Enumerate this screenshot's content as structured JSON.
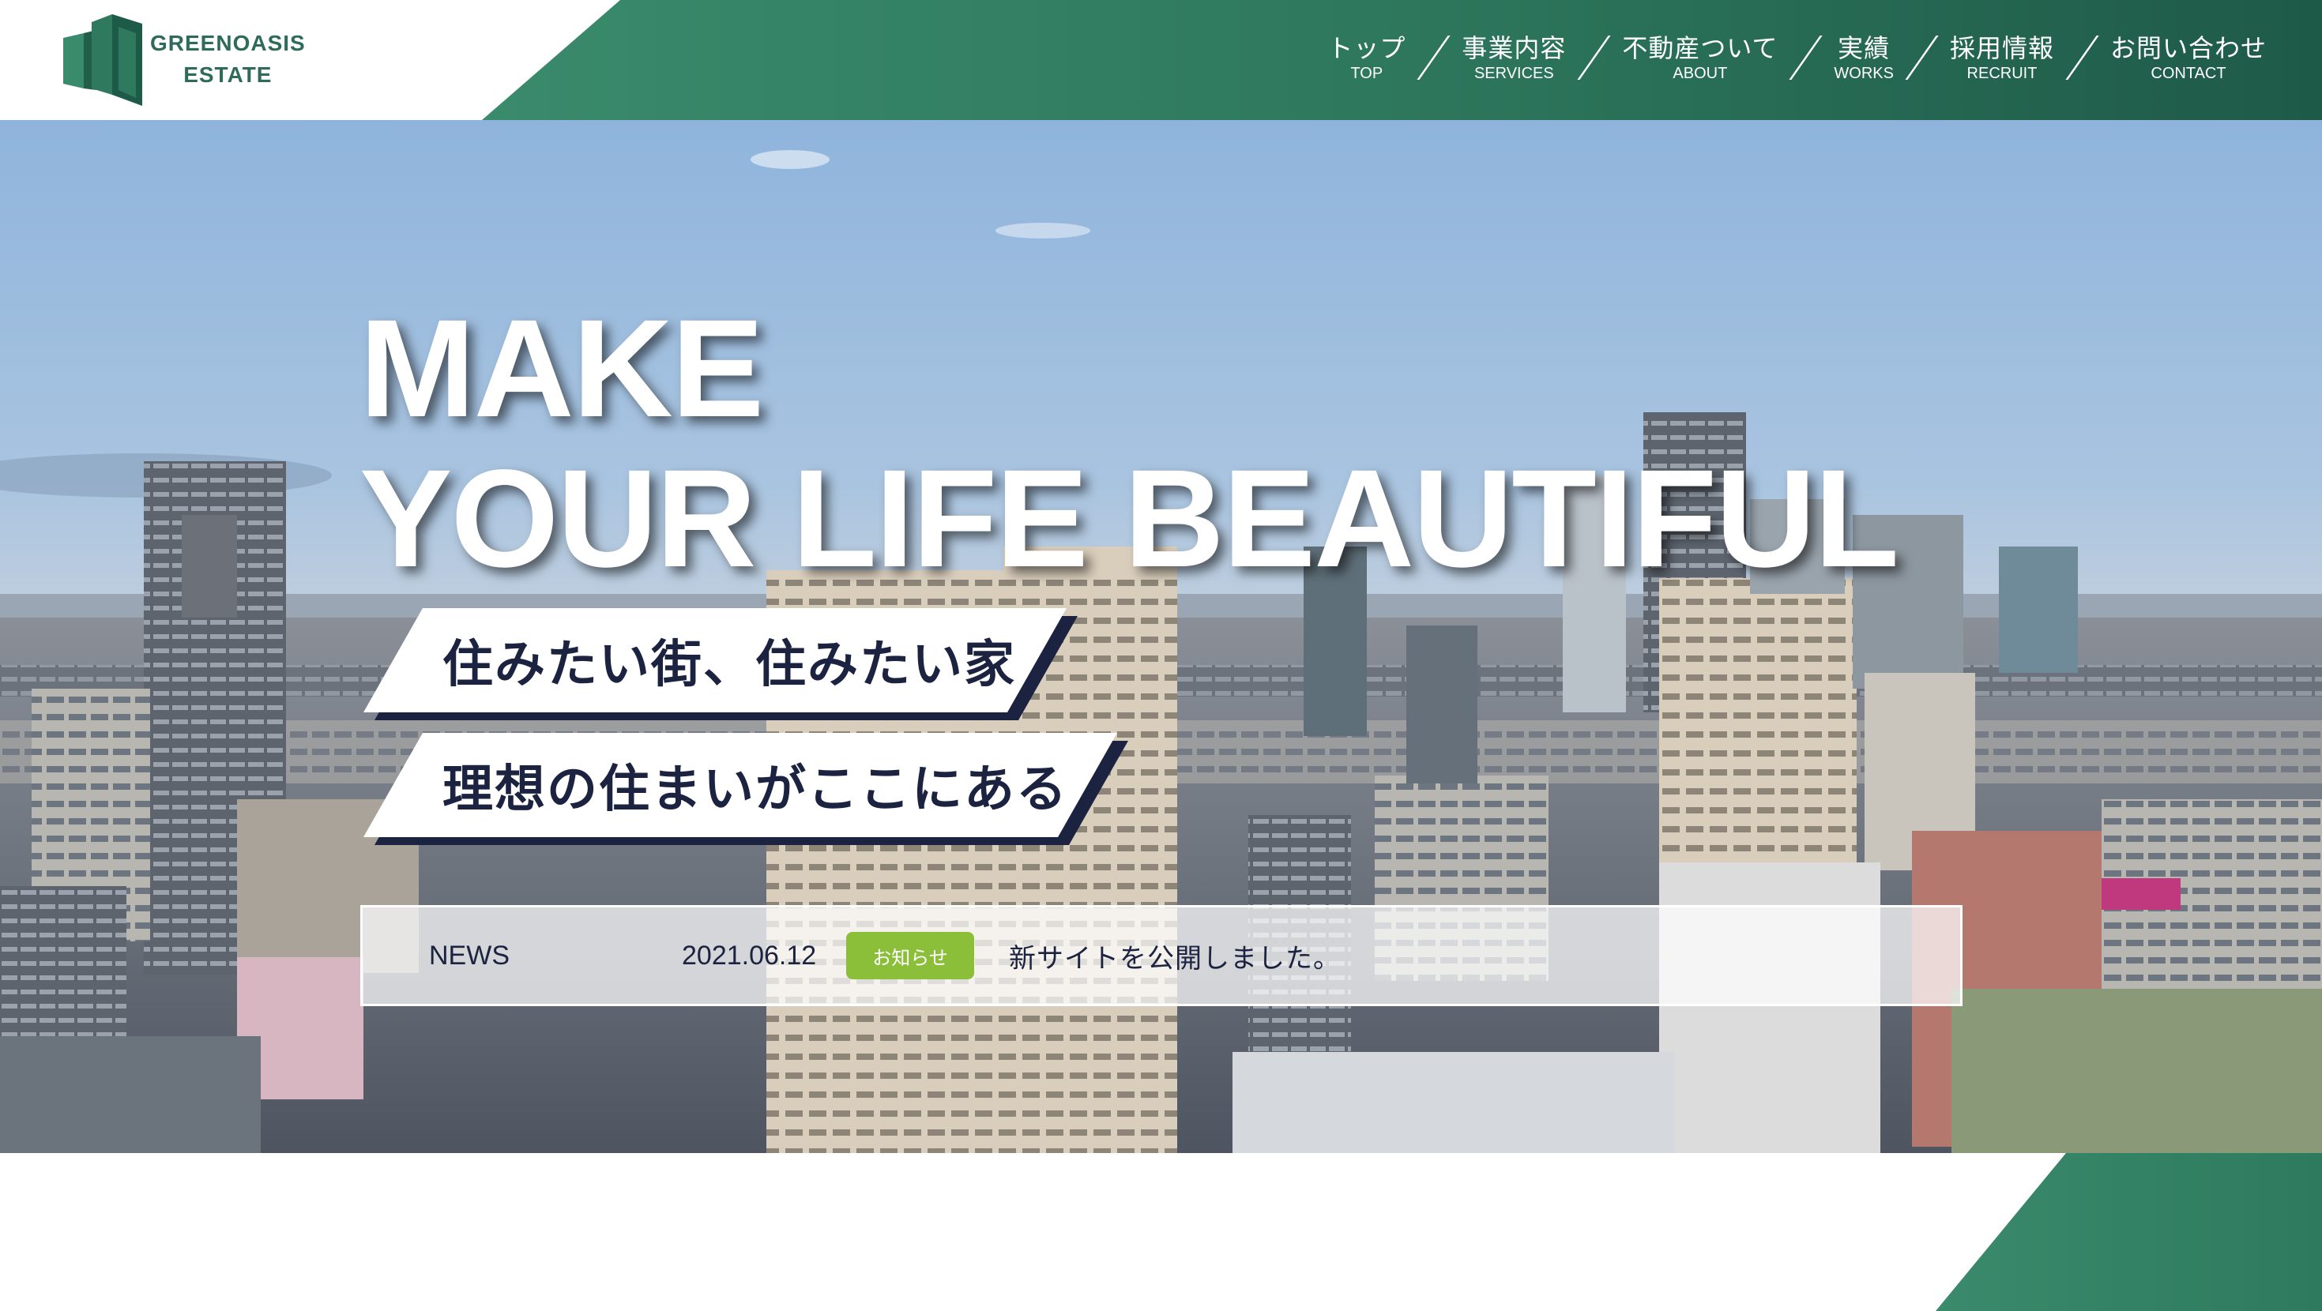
{
  "brand": {
    "line1": "GREENOASIS",
    "line2": "ESTATE",
    "logo_icon": "building-logo-icon",
    "color": "#2e6b58"
  },
  "nav": {
    "items": [
      {
        "jp": "トップ",
        "en": "TOP"
      },
      {
        "jp": "事業内容",
        "en": "SERVICES"
      },
      {
        "jp": "不動産ついて",
        "en": "ABOUT"
      },
      {
        "jp": "実績",
        "en": "WORKS"
      },
      {
        "jp": "採用情報",
        "en": "RECRUIT"
      },
      {
        "jp": "お問い合わせ",
        "en": "CONTACT"
      }
    ]
  },
  "hero": {
    "headline_line1": "MAKE",
    "headline_line2": "YOUR LIFE BEAUTIFUL",
    "tagline1": "住みたい街、住みたい家",
    "tagline2": "理想の住まいがここにある"
  },
  "news": {
    "label": "NEWS",
    "date": "2021.06.12",
    "badge": "お知らせ",
    "text": "新サイトを公開しました。"
  },
  "colors": {
    "accent_green": "#2f7a5f",
    "navy": "#1b2340",
    "badge_green": "#8bbf3a"
  }
}
